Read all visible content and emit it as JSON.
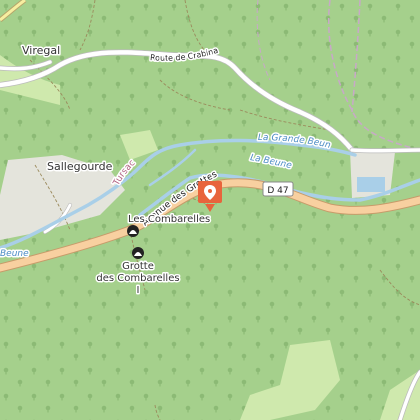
{
  "map": {
    "places": {
      "viregal": "Viregal",
      "sallegourde": "Sallegourde",
      "les_combarelles": "Les Combarelles",
      "grotte_line1": "Grotte",
      "grotte_line2": "des Combarelles",
      "grotte_line3": "I"
    },
    "roads": {
      "route_crabinac": "Route de Crabinac",
      "avenue_grottes": "Avenue des Grottes",
      "d47_shield": "D 47"
    },
    "water": {
      "grande_beune": "La Grande Beune",
      "la_beune": "La Beune",
      "beune_left": "Beune"
    },
    "other": {
      "tursac": "Tursac"
    },
    "poi": {
      "icon": "map-pin-icon",
      "color": "#e8643c"
    },
    "colors": {
      "forest": "#a5d08c",
      "meadow": "#cfe9ad",
      "main_road": "#f8d0a0",
      "main_road_casing": "#c79b6a",
      "water": "#a9cfe8",
      "settlement": "#e4e4dc",
      "boundary": "#c8a8c8",
      "track": "#9b8a5c"
    }
  }
}
